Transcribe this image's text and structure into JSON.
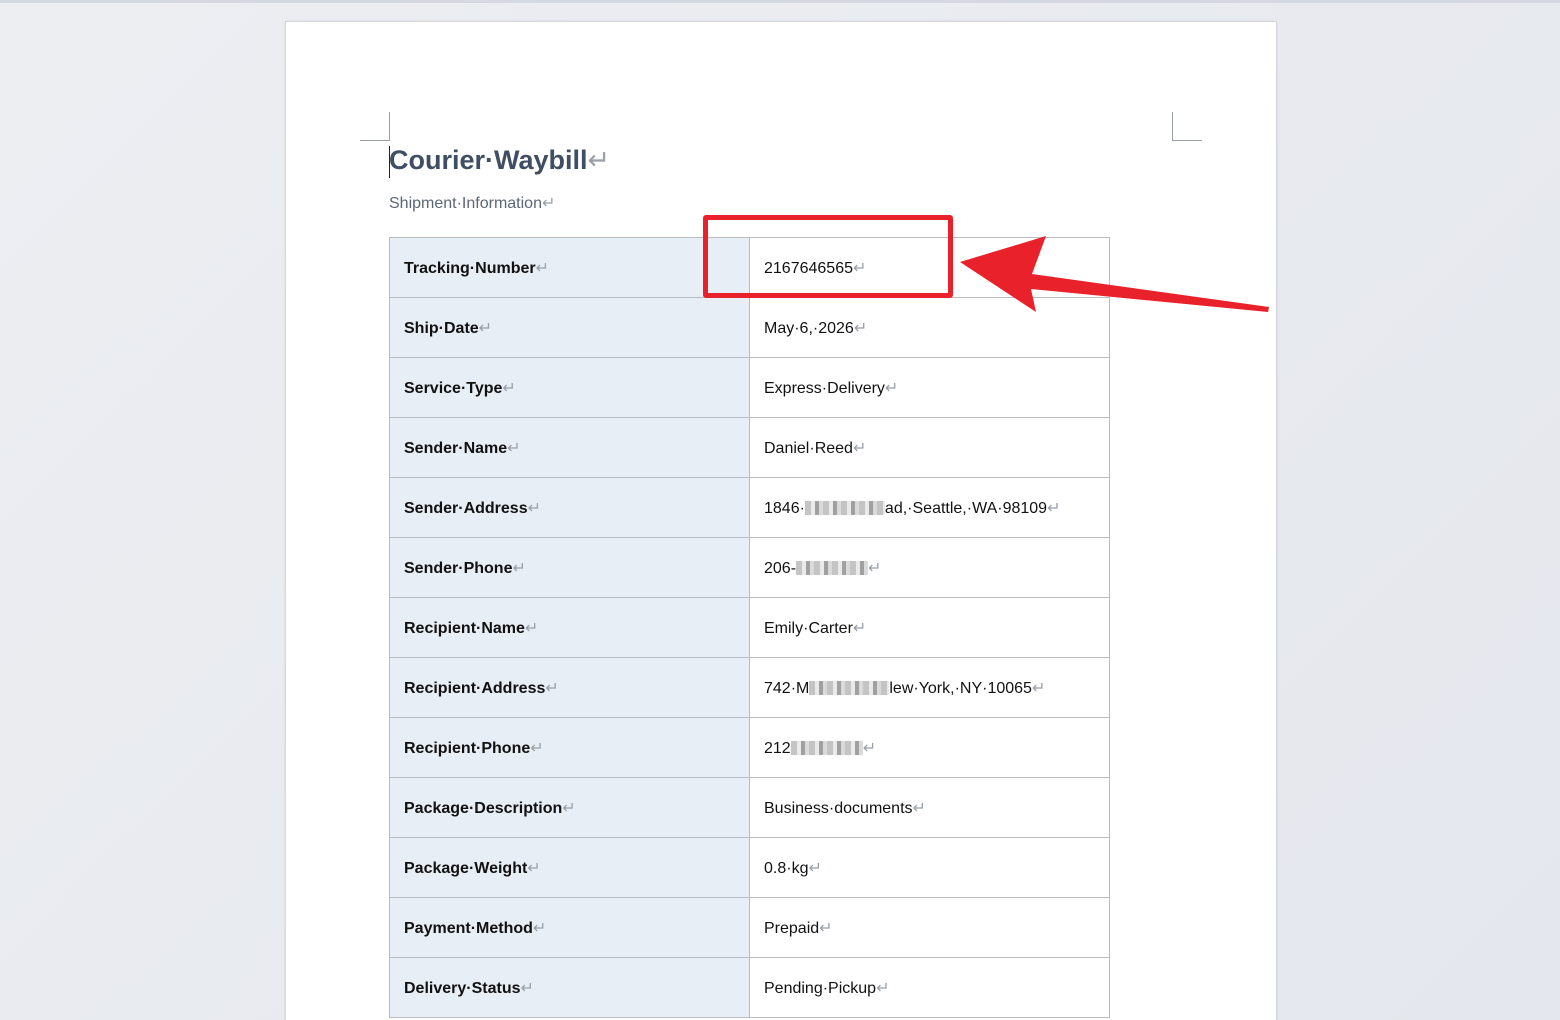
{
  "document": {
    "title": "Courier·Waybill",
    "subtitle": "Shipment·Information",
    "paragraph_mark": "↵"
  },
  "waybill": {
    "rows": [
      {
        "label": "Tracking·Number",
        "value": "2167646565"
      },
      {
        "label": "Ship·Date",
        "value": "May·6,·2026"
      },
      {
        "label": "Service·Type",
        "value": "Express·Delivery"
      },
      {
        "label": "Sender·Name",
        "value": "Daniel·Reed"
      },
      {
        "label": "Sender·Address",
        "value_prefix": "1846·",
        "value_suffix": "ad,·Seattle,·WA·98109",
        "redacted": true
      },
      {
        "label": "Sender·Phone",
        "value_prefix": "206-",
        "value_suffix": "",
        "redacted": true
      },
      {
        "label": "Recipient·Name",
        "value": "Emily·Carter"
      },
      {
        "label": "Recipient·Address",
        "value_prefix": "742·M",
        "value_suffix": "lew·York,·NY·10065",
        "redacted": true
      },
      {
        "label": "Recipient·Phone",
        "value_prefix": "212",
        "value_suffix": "",
        "redacted": true
      },
      {
        "label": "Package·Description",
        "value": "Business·documents"
      },
      {
        "label": "Package·Weight",
        "value": "0.8·kg"
      },
      {
        "label": "Payment·Method",
        "value": "Prepaid"
      },
      {
        "label": "Delivery·Status",
        "value": "Pending·Pickup"
      }
    ]
  },
  "annotation": {
    "highlight_color": "#e8212b",
    "target": "tracking-number-value"
  }
}
